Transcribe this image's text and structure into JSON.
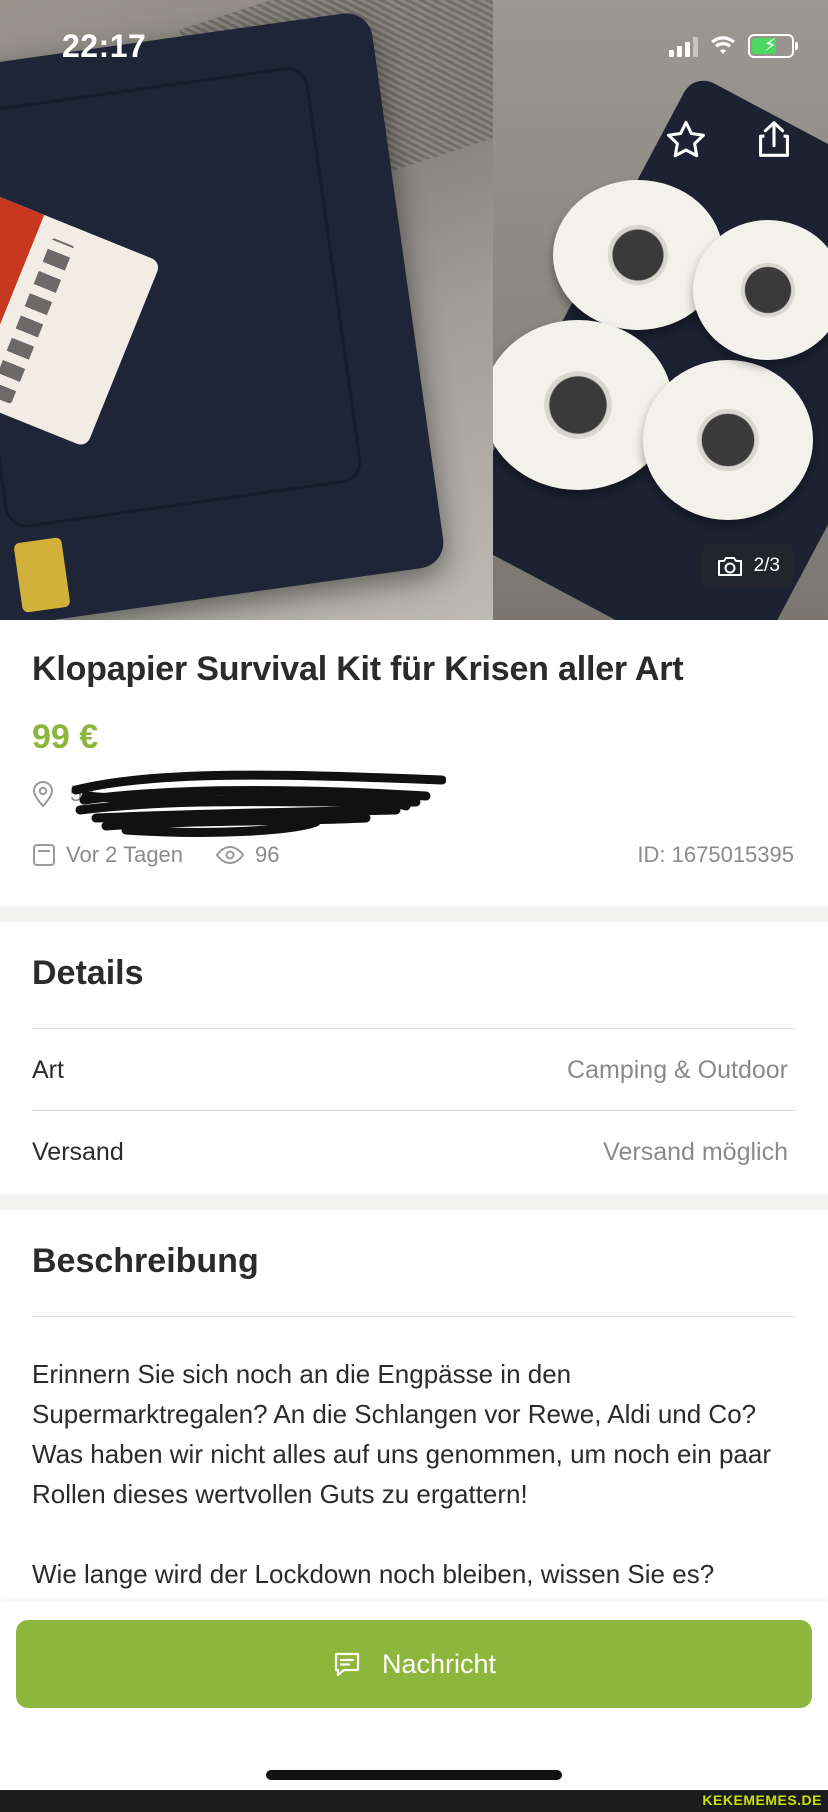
{
  "status_bar": {
    "time": "22:17"
  },
  "gallery": {
    "counter": "2/3"
  },
  "listing": {
    "title": "Klopapier Survival Kit für Krisen aller Art",
    "price": "99 €",
    "location": "52...",
    "posted": "Vor 2 Tagen",
    "views": "96",
    "id": "ID: 1675015395"
  },
  "details": {
    "heading": "Details",
    "rows": [
      {
        "key": "Art",
        "value": "Camping & Outdoor"
      },
      {
        "key": "Versand",
        "value": "Versand möglich"
      }
    ]
  },
  "description": {
    "heading": "Beschreibung",
    "paragraph1": "Erinnern Sie sich noch an die Engpässe in den Supermarktregalen? An die Schlangen vor Rewe, Aldi und Co? Was haben wir nicht alles auf uns genommen, um noch ein paar Rollen dieses wertvollen Guts zu ergattern!",
    "paragraph2": "Wie lange wird der Lockdown noch bleiben, wissen Sie es?"
  },
  "actions": {
    "message_label": "Nachricht"
  },
  "watermark": "KEKEMEMES.DE",
  "colors": {
    "accent": "#8cb63c",
    "text": "#2b2b2b",
    "muted": "#8a8a8a"
  },
  "icons": [
    "star-icon",
    "share-icon",
    "camera-icon",
    "location-pin-icon",
    "calendar-icon",
    "eye-icon",
    "chat-icon"
  ]
}
